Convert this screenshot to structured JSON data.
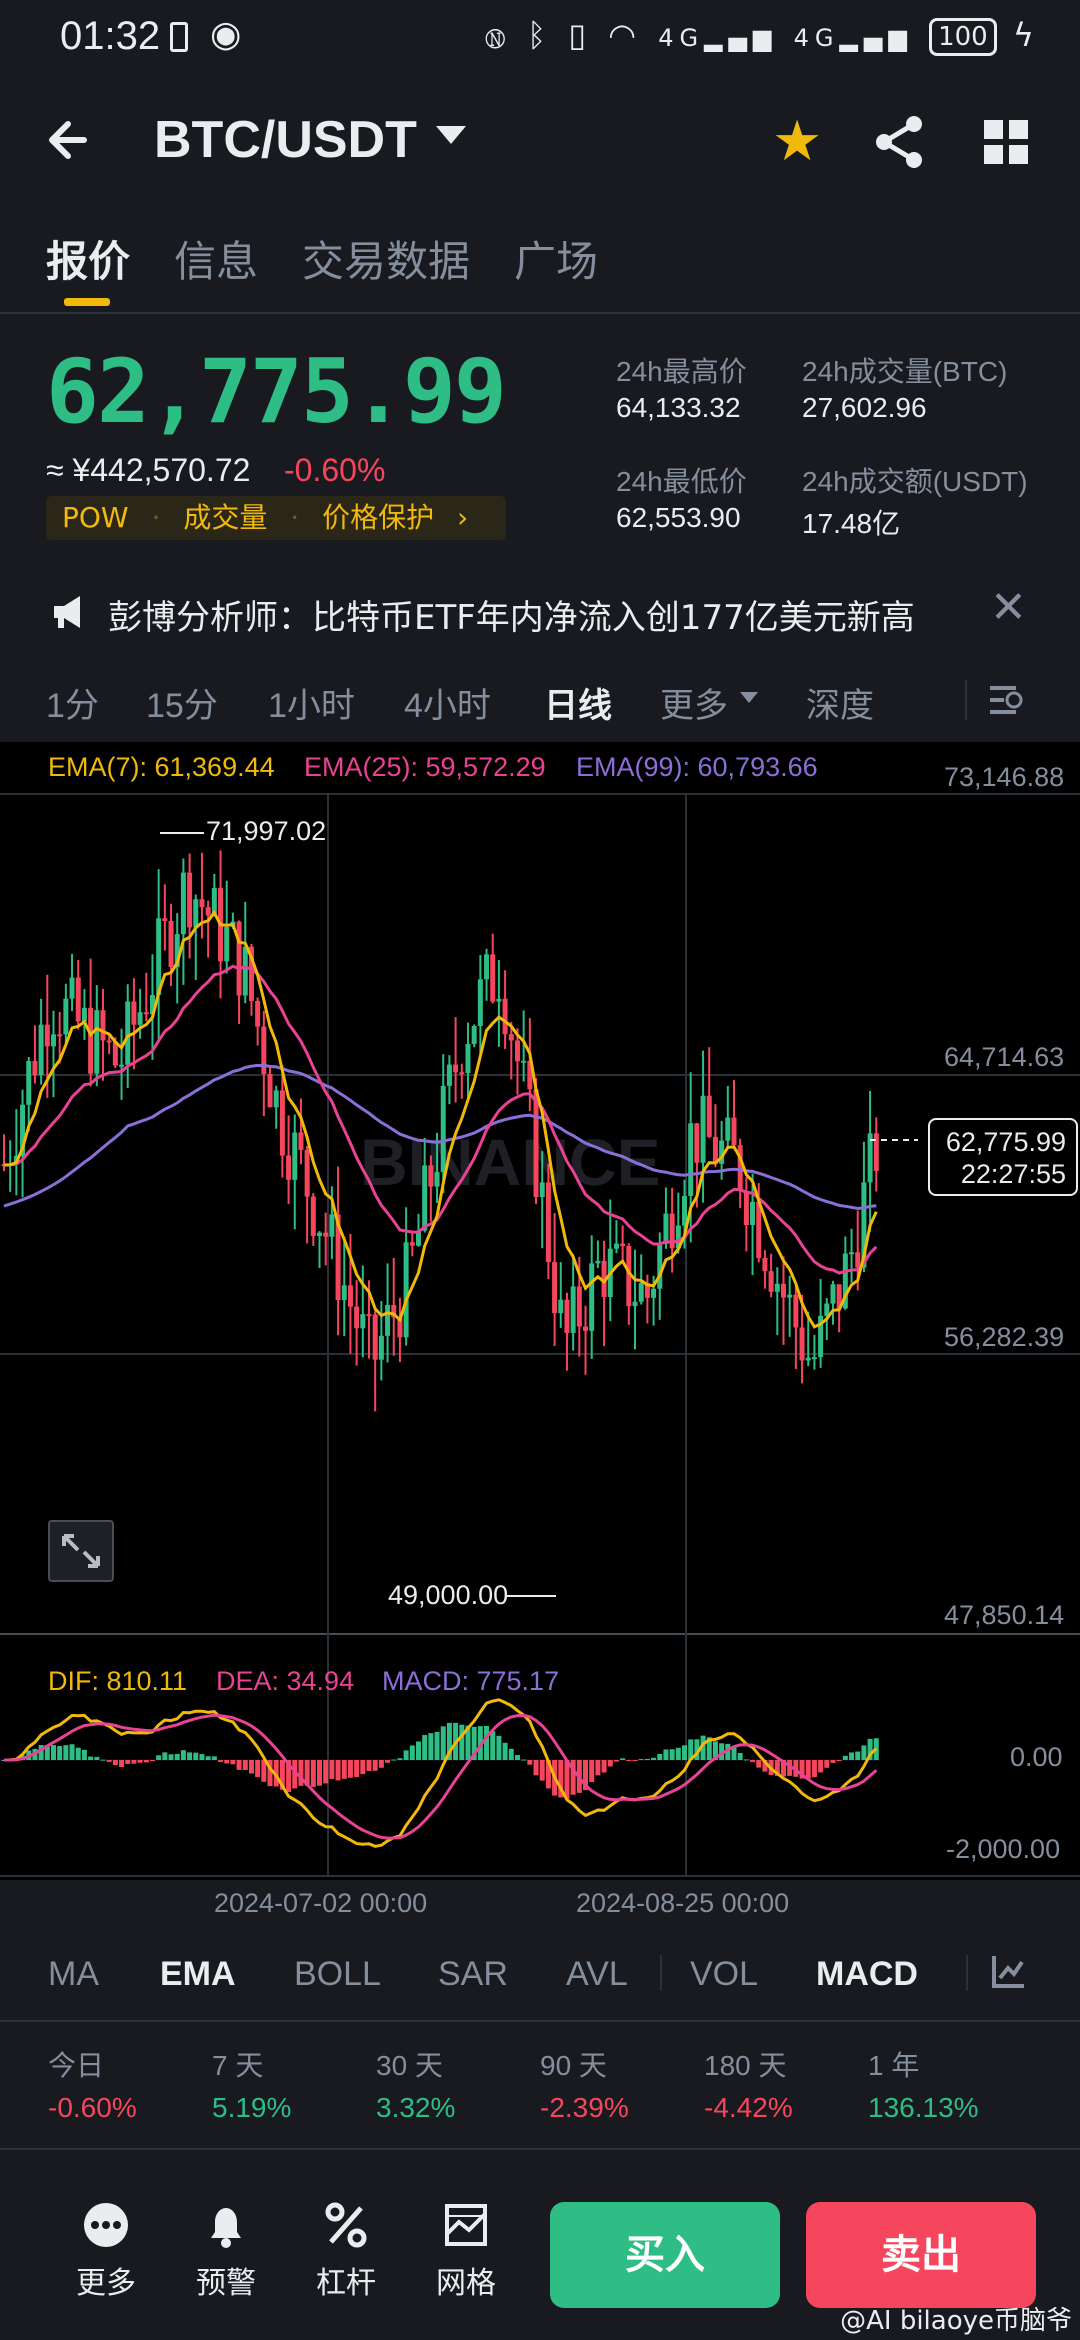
{
  "status_bar": {
    "time": "01:32",
    "network": "4G",
    "battery": "100"
  },
  "header": {
    "pair": "BTC/USDT",
    "icons": [
      "back-icon",
      "dropdown-icon",
      "star-icon",
      "share-icon",
      "grid-icon"
    ]
  },
  "tabs": [
    {
      "label": "报价",
      "active": true
    },
    {
      "label": "信息",
      "active": false
    },
    {
      "label": "交易数据",
      "active": false
    },
    {
      "label": "广场",
      "active": false
    }
  ],
  "price": {
    "last": "62,775.99",
    "fiat": "≈ ¥442,570.72",
    "change": "-0.60%",
    "tags": [
      "POW",
      "成交量",
      "价格保护"
    ],
    "tag_arrow": "›"
  },
  "stats": {
    "high_label": "24h最高价",
    "high": "64,133.32",
    "vol_btc_label": "24h成交量(BTC)",
    "vol_btc": "27,602.96",
    "low_label": "24h最低价",
    "low": "62,553.90",
    "vol_usdt_label": "24h成交额(USDT)",
    "vol_usdt": "17.48亿"
  },
  "announcement": {
    "text": "彭博分析师：比特币ETF年内净流入创177亿美元新高",
    "close": "✕"
  },
  "intervals": [
    {
      "label": "1分",
      "active": false
    },
    {
      "label": "15分",
      "active": false
    },
    {
      "label": "1小时",
      "active": false
    },
    {
      "label": "4小时",
      "active": false
    },
    {
      "label": "日线",
      "active": true
    },
    {
      "label": "更多",
      "active": false
    },
    {
      "label": "深度",
      "active": false
    }
  ],
  "chart": {
    "ema7": "EMA(7): 61,369.44",
    "ema25": "EMA(25): 59,572.29",
    "ema99": "EMA(99): 60,793.66",
    "y_labels": [
      "73,146.88",
      "64,714.63",
      "56,282.39",
      "47,850.14"
    ],
    "high_marker": "71,997.02",
    "low_marker": "49,000.00",
    "price_tag_value": "62,775.99",
    "price_tag_time": "22:27:55",
    "watermark": "BINANCE",
    "macd_dif": "DIF: 810.11",
    "macd_dea": "DEA: 34.94",
    "macd_val": "MACD: 775.17",
    "macd_y_labels": [
      "0.00",
      "-2,000.00"
    ],
    "x_labels": [
      "2024-07-02 00:00",
      "2024-08-25 00:00"
    ],
    "colors": {
      "up": "#2ebd85",
      "down": "#f6465d",
      "ema7": "#f0b90b",
      "ema25": "#e84393",
      "ema99": "#8b6fd8"
    }
  },
  "indicators": [
    {
      "label": "MA",
      "active": false
    },
    {
      "label": "EMA",
      "active": true
    },
    {
      "label": "BOLL",
      "active": false
    },
    {
      "label": "SAR",
      "active": false
    },
    {
      "label": "AVL",
      "active": false
    },
    {
      "label": "VOL",
      "active": false
    },
    {
      "label": "MACD",
      "active": true
    }
  ],
  "performance": [
    {
      "label": "今日",
      "value": "-0.60%",
      "dir": "down"
    },
    {
      "label": "7 天",
      "value": "5.19%",
      "dir": "up"
    },
    {
      "label": "30 天",
      "value": "3.32%",
      "dir": "up"
    },
    {
      "label": "90 天",
      "value": "-2.39%",
      "dir": "down"
    },
    {
      "label": "180 天",
      "value": "-4.42%",
      "dir": "down"
    },
    {
      "label": "1 年",
      "value": "136.13%",
      "dir": "up"
    }
  ],
  "bottom": {
    "more": "更多",
    "alert": "预警",
    "leverage": "杠杆",
    "grid": "网格",
    "buy": "买入",
    "sell": "卖出"
  },
  "watermark_text": "@AI bilaoye币脑爷"
}
